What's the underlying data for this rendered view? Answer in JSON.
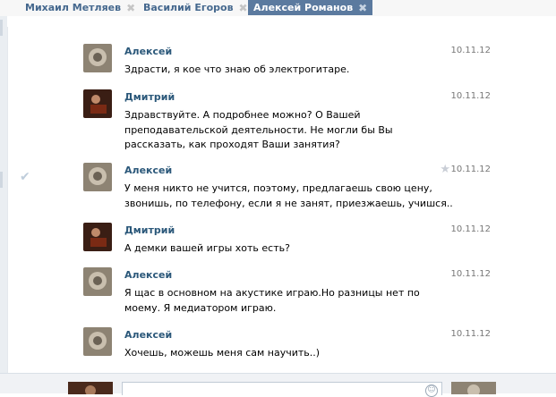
{
  "tabs": [
    {
      "label": "Михаил Метляев"
    },
    {
      "label": "Василий Егоров"
    },
    {
      "label": "Алексей Романов"
    }
  ],
  "messages": [
    {
      "author": "Алексей",
      "date": "10.11.12",
      "text": "Здрасти, я кое что знаю об электрогитаре."
    },
    {
      "author": "Дмитрий",
      "date": "10.11.12",
      "text": "Здравствуйте. А подробнее можно? О Вашей преподавательской деятельности. Не могли бы Вы рассказать, как проходят Ваши занятия?"
    },
    {
      "author": "Алексей",
      "date": "10.11.12",
      "text": "У меня никто не учится, поэтому, предлагаешь свою цену, звонишь, по телефону, если я не занят, приезжаешь, учишся.."
    },
    {
      "author": "Дмитрий",
      "date": "10.11.12",
      "text": "А демки вашей игры хоть есть?"
    },
    {
      "author": "Алексей",
      "date": "10.11.12",
      "text": "Я щас в основном на акустике играю.Но разницы нет по моему. Я медиатором играю."
    },
    {
      "author": "Алексей",
      "date": "10.11.12",
      "text": "Хочешь, можешь меня сам научить..)"
    }
  ],
  "colors": {
    "link": "#2b587a",
    "active_tab": "#5b7a9f"
  },
  "icons": {
    "tab_close": "close-icon",
    "selected": "check-icon",
    "favorite": "star-icon",
    "emoji": "smile-icon"
  }
}
